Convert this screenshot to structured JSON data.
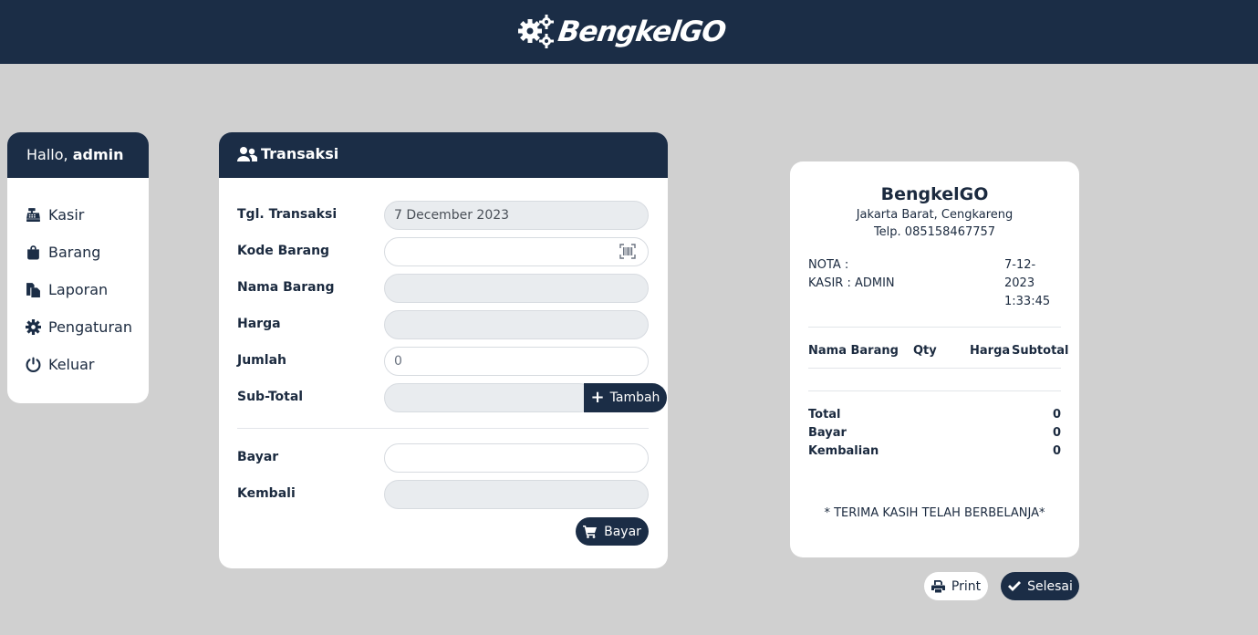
{
  "brand": {
    "name": "BengkelGO",
    "logo_icon": "gears-icon"
  },
  "sidebar": {
    "greeting_prefix": "Hallo,",
    "user": "admin",
    "items": [
      {
        "label": "Kasir",
        "icon": "cash-register-icon"
      },
      {
        "label": "Barang",
        "icon": "shopping-bag-icon"
      },
      {
        "label": "Laporan",
        "icon": "copy-icon"
      },
      {
        "label": "Pengaturan",
        "icon": "gear-icon"
      },
      {
        "label": "Keluar",
        "icon": "power-icon"
      }
    ]
  },
  "transaksi": {
    "title": "Transaksi",
    "icon": "users-icon",
    "fields": {
      "tgl": {
        "label": "Tgl. Transaksi",
        "value": "7 December 2023"
      },
      "kode": {
        "label": "Kode Barang",
        "value": ""
      },
      "nama": {
        "label": "Nama Barang",
        "value": ""
      },
      "harga": {
        "label": "Harga",
        "value": ""
      },
      "jumlah": {
        "label": "Jumlah",
        "value": "0"
      },
      "subtotal": {
        "label": "Sub-Total",
        "value": ""
      },
      "bayar": {
        "label": "Bayar",
        "value": ""
      },
      "kembali": {
        "label": "Kembali",
        "value": ""
      }
    },
    "tambah_label": "Tambah",
    "bayar_button": "Bayar"
  },
  "receipt": {
    "title": "BengkelGO",
    "address": "Jakarta Barat, Cengkareng",
    "phone": "Telp. 085158467757",
    "nota": "NOTA :",
    "kasir": "KASIR : ADMIN",
    "date_lines": [
      "7-12-",
      "2023",
      "1:33:45"
    ],
    "columns": [
      "Nama Barang",
      "Qty",
      "Harga",
      "Subtotal"
    ],
    "summary": {
      "total_label": "Total",
      "total_value": "0",
      "bayar_label": "Bayar",
      "bayar_value": "0",
      "kembalian_label": "Kembalian",
      "kembalian_value": "0"
    },
    "thanks": "* TERIMA KASIH TELAH BERBELANJA*"
  },
  "actions": {
    "print": "Print",
    "selesai": "Selesai"
  },
  "colors": {
    "navy": "#1b2d46",
    "background": "#d0d0d0",
    "field_bg": "#e9ecef"
  }
}
